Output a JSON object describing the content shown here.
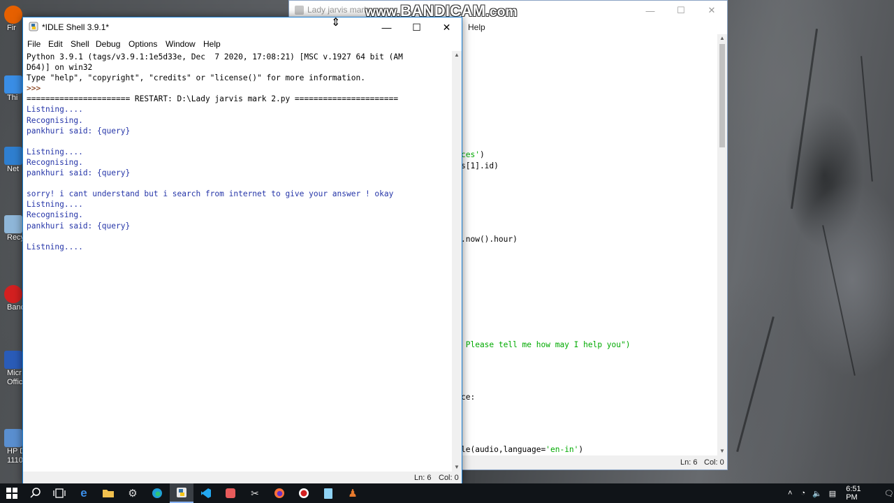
{
  "desktop": {
    "icons": [
      {
        "label": "Fir"
      },
      {
        "label": "Thi"
      },
      {
        "label": "Net"
      },
      {
        "label": "Recy"
      },
      {
        "label": "Banc"
      },
      {
        "label": "Micr"
      },
      {
        "label": "Offic"
      },
      {
        "label": "HP D"
      },
      {
        "label": "1110"
      }
    ]
  },
  "watermark": {
    "text_www": "www.",
    "text_brand": "BANDICAM",
    "text_com": ".com"
  },
  "editor": {
    "title": "Lady jarvis mark",
    "menu_help": "Help",
    "min_glyph": "—",
    "max_glyph": "☐",
    "close_glyph": "✕",
    "code_lines": [
      {
        "text": "ces')",
        "style": "green-tail"
      },
      {
        "text": "s[1].id)",
        "style": "plain"
      },
      {
        "text": ".now().hour)",
        "style": "plain"
      },
      {
        "text": " Please tell me how may I help you\")",
        "style": "green"
      },
      {
        "text": "ce:",
        "style": "plain"
      },
      {
        "text": "le(audio,language='en-in')",
        "style": "mixed"
      }
    ],
    "status_ln": "Ln: 6",
    "status_col": "Col: 0"
  },
  "shell": {
    "title": "*IDLE Shell 3.9.1*",
    "min_glyph": "—",
    "max_glyph": "☐",
    "close_glyph": "✕",
    "menu": [
      "File",
      "Edit",
      "Shell",
      "Debug",
      "Options",
      "Window",
      "Help"
    ],
    "lines": [
      {
        "text": "Python 3.9.1 (tags/v3.9.1:1e5d33e, Dec  7 2020, 17:08:21) [MSC v.1927 64 bit (AM",
        "color": "black"
      },
      {
        "text": "D64)] on win32",
        "color": "black"
      },
      {
        "text": "Type \"help\", \"copyright\", \"credits\" or \"license()\" for more information.",
        "color": "black"
      },
      {
        "text": ">>> ",
        "color": "prompt"
      },
      {
        "text": "====================== RESTART: D:\\Lady jarvis mark 2.py ======================",
        "color": "black"
      },
      {
        "text": "Listning....",
        "color": "blue"
      },
      {
        "text": "Recognising.",
        "color": "blue"
      },
      {
        "text": "pankhuri said: {query}",
        "color": "blue"
      },
      {
        "text": "",
        "color": "blue"
      },
      {
        "text": "Listning....",
        "color": "blue"
      },
      {
        "text": "Recognising.",
        "color": "blue"
      },
      {
        "text": "pankhuri said: {query}",
        "color": "blue"
      },
      {
        "text": "",
        "color": "blue"
      },
      {
        "text": "sorry! i cant understand but i search from internet to give your answer ! okay",
        "color": "blue"
      },
      {
        "text": "Listning....",
        "color": "blue"
      },
      {
        "text": "Recognising.",
        "color": "blue"
      },
      {
        "text": "pankhuri said: {query}",
        "color": "blue"
      },
      {
        "text": "",
        "color": "blue"
      },
      {
        "text": "Listning....",
        "color": "blue"
      }
    ],
    "status_ln": "Ln: 6",
    "status_col": "Col: 0"
  },
  "taskbar": {
    "items": [
      {
        "name": "start-button",
        "icon": "windows-logo"
      },
      {
        "name": "search-button",
        "icon": "search-icon"
      },
      {
        "name": "task-view-button",
        "icon": "task-view-icon"
      },
      {
        "name": "edge-legacy-button",
        "icon": "edge-legacy-icon"
      },
      {
        "name": "file-explorer-button",
        "icon": "folder-icon"
      },
      {
        "name": "edge-button",
        "icon": "edge-icon"
      },
      {
        "name": "idle-button",
        "icon": "python-idle-icon"
      },
      {
        "name": "vscode-button",
        "icon": "vscode-icon"
      },
      {
        "name": "app-button",
        "icon": "app-icon"
      },
      {
        "name": "app2-button",
        "icon": "app-icon"
      },
      {
        "name": "firefox-button",
        "icon": "firefox-icon"
      },
      {
        "name": "bandicam-button",
        "icon": "bandicam-icon"
      },
      {
        "name": "notepad-button",
        "icon": "notepad-icon"
      },
      {
        "name": "python-button",
        "icon": "python-icon"
      }
    ],
    "clock": "6:51 PM"
  },
  "colors": {
    "shell_blue": "#2535a8",
    "prompt_brown": "#7a2b00",
    "code_green": "#00aa00",
    "taskbar_bg": "#101418"
  }
}
